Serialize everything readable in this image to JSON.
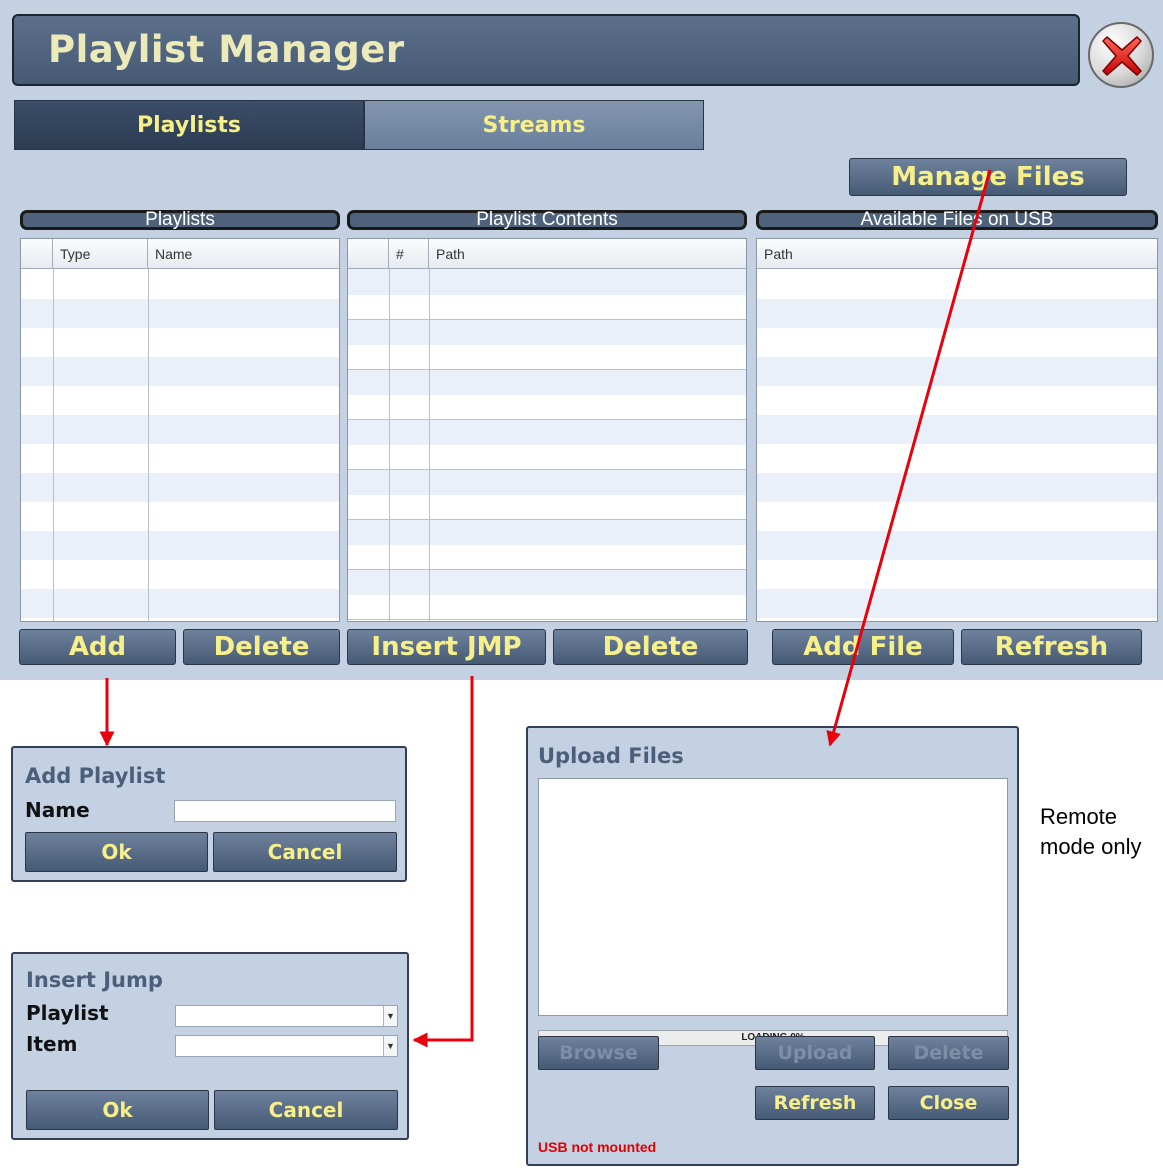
{
  "window": {
    "title": "Playlist Manager"
  },
  "tabs": [
    {
      "label": "Playlists",
      "active": true
    },
    {
      "label": "Streams",
      "active": false
    }
  ],
  "manage_files_label": "Manage Files",
  "sections": {
    "playlists": {
      "header": "Playlists",
      "columns": [
        "",
        "Type",
        "Name"
      ],
      "buttons": [
        "Add",
        "Delete"
      ]
    },
    "contents": {
      "header": "Playlist Contents",
      "columns": [
        "",
        "#",
        "Path"
      ],
      "buttons": [
        "Insert JMP",
        "Delete"
      ]
    },
    "usb": {
      "header": "Available Files on USB",
      "columns": [
        "Path"
      ],
      "buttons": [
        "Add File",
        "Refresh"
      ]
    }
  },
  "add_playlist_dialog": {
    "title": "Add Playlist",
    "name_label": "Name",
    "name_value": "",
    "ok": "Ok",
    "cancel": "Cancel"
  },
  "insert_jump_dialog": {
    "title": "Insert Jump",
    "playlist_label": "Playlist",
    "playlist_value": "",
    "item_label": "Item",
    "item_value": "",
    "ok": "Ok",
    "cancel": "Cancel"
  },
  "upload_dialog": {
    "title": "Upload Files",
    "progress_text": "LOADING 0%",
    "progress": 0,
    "browse": "Browse",
    "upload": "Upload",
    "delete": "Delete",
    "refresh": "Refresh",
    "close": "Close",
    "status": "USB not mounted"
  },
  "note": "Remote mode only",
  "colors": {
    "panel": "#c3d1e3",
    "button_text": "#f7f08a",
    "annotation_arrow": "#e8000b",
    "status_error": "#e00000"
  }
}
